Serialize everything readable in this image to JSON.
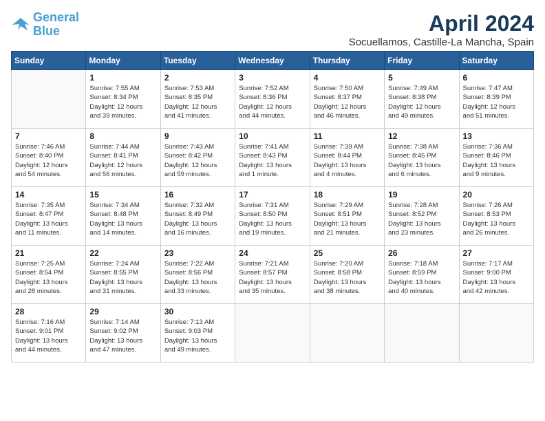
{
  "logo": {
    "line1": "General",
    "line2": "Blue"
  },
  "title": "April 2024",
  "subtitle": "Socuellamos, Castille-La Mancha, Spain",
  "days": [
    "Sunday",
    "Monday",
    "Tuesday",
    "Wednesday",
    "Thursday",
    "Friday",
    "Saturday"
  ],
  "weeks": [
    [
      {
        "num": "",
        "info": ""
      },
      {
        "num": "1",
        "info": "Sunrise: 7:55 AM\nSunset: 8:34 PM\nDaylight: 12 hours\nand 39 minutes."
      },
      {
        "num": "2",
        "info": "Sunrise: 7:53 AM\nSunset: 8:35 PM\nDaylight: 12 hours\nand 41 minutes."
      },
      {
        "num": "3",
        "info": "Sunrise: 7:52 AM\nSunset: 8:36 PM\nDaylight: 12 hours\nand 44 minutes."
      },
      {
        "num": "4",
        "info": "Sunrise: 7:50 AM\nSunset: 8:37 PM\nDaylight: 12 hours\nand 46 minutes."
      },
      {
        "num": "5",
        "info": "Sunrise: 7:49 AM\nSunset: 8:38 PM\nDaylight: 12 hours\nand 49 minutes."
      },
      {
        "num": "6",
        "info": "Sunrise: 7:47 AM\nSunset: 8:39 PM\nDaylight: 12 hours\nand 51 minutes."
      }
    ],
    [
      {
        "num": "7",
        "info": "Sunrise: 7:46 AM\nSunset: 8:40 PM\nDaylight: 12 hours\nand 54 minutes."
      },
      {
        "num": "8",
        "info": "Sunrise: 7:44 AM\nSunset: 8:41 PM\nDaylight: 12 hours\nand 56 minutes."
      },
      {
        "num": "9",
        "info": "Sunrise: 7:43 AM\nSunset: 8:42 PM\nDaylight: 12 hours\nand 59 minutes."
      },
      {
        "num": "10",
        "info": "Sunrise: 7:41 AM\nSunset: 8:43 PM\nDaylight: 13 hours\nand 1 minute."
      },
      {
        "num": "11",
        "info": "Sunrise: 7:39 AM\nSunset: 8:44 PM\nDaylight: 13 hours\nand 4 minutes."
      },
      {
        "num": "12",
        "info": "Sunrise: 7:38 AM\nSunset: 8:45 PM\nDaylight: 13 hours\nand 6 minutes."
      },
      {
        "num": "13",
        "info": "Sunrise: 7:36 AM\nSunset: 8:46 PM\nDaylight: 13 hours\nand 9 minutes."
      }
    ],
    [
      {
        "num": "14",
        "info": "Sunrise: 7:35 AM\nSunset: 8:47 PM\nDaylight: 13 hours\nand 11 minutes."
      },
      {
        "num": "15",
        "info": "Sunrise: 7:34 AM\nSunset: 8:48 PM\nDaylight: 13 hours\nand 14 minutes."
      },
      {
        "num": "16",
        "info": "Sunrise: 7:32 AM\nSunset: 8:49 PM\nDaylight: 13 hours\nand 16 minutes."
      },
      {
        "num": "17",
        "info": "Sunrise: 7:31 AM\nSunset: 8:50 PM\nDaylight: 13 hours\nand 19 minutes."
      },
      {
        "num": "18",
        "info": "Sunrise: 7:29 AM\nSunset: 8:51 PM\nDaylight: 13 hours\nand 21 minutes."
      },
      {
        "num": "19",
        "info": "Sunrise: 7:28 AM\nSunset: 8:52 PM\nDaylight: 13 hours\nand 23 minutes."
      },
      {
        "num": "20",
        "info": "Sunrise: 7:26 AM\nSunset: 8:53 PM\nDaylight: 13 hours\nand 26 minutes."
      }
    ],
    [
      {
        "num": "21",
        "info": "Sunrise: 7:25 AM\nSunset: 8:54 PM\nDaylight: 13 hours\nand 28 minutes."
      },
      {
        "num": "22",
        "info": "Sunrise: 7:24 AM\nSunset: 8:55 PM\nDaylight: 13 hours\nand 31 minutes."
      },
      {
        "num": "23",
        "info": "Sunrise: 7:22 AM\nSunset: 8:56 PM\nDaylight: 13 hours\nand 33 minutes."
      },
      {
        "num": "24",
        "info": "Sunrise: 7:21 AM\nSunset: 8:57 PM\nDaylight: 13 hours\nand 35 minutes."
      },
      {
        "num": "25",
        "info": "Sunrise: 7:20 AM\nSunset: 8:58 PM\nDaylight: 13 hours\nand 38 minutes."
      },
      {
        "num": "26",
        "info": "Sunrise: 7:18 AM\nSunset: 8:59 PM\nDaylight: 13 hours\nand 40 minutes."
      },
      {
        "num": "27",
        "info": "Sunrise: 7:17 AM\nSunset: 9:00 PM\nDaylight: 13 hours\nand 42 minutes."
      }
    ],
    [
      {
        "num": "28",
        "info": "Sunrise: 7:16 AM\nSunset: 9:01 PM\nDaylight: 13 hours\nand 44 minutes."
      },
      {
        "num": "29",
        "info": "Sunrise: 7:14 AM\nSunset: 9:02 PM\nDaylight: 13 hours\nand 47 minutes."
      },
      {
        "num": "30",
        "info": "Sunrise: 7:13 AM\nSunset: 9:03 PM\nDaylight: 13 hours\nand 49 minutes."
      },
      {
        "num": "",
        "info": ""
      },
      {
        "num": "",
        "info": ""
      },
      {
        "num": "",
        "info": ""
      },
      {
        "num": "",
        "info": ""
      }
    ]
  ]
}
